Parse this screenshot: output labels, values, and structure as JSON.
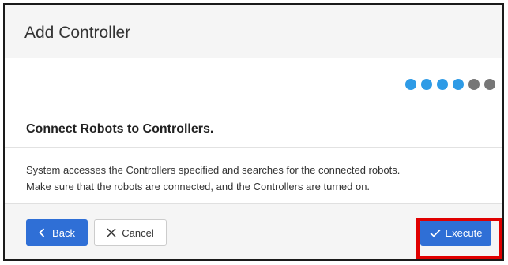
{
  "dialog": {
    "title": "Add Controller",
    "heading": "Connect Robots to Controllers.",
    "description_line1": "System accesses the Controllers specified and searches for the connected robots.",
    "description_line2": "Make sure that the robots are connected, and the Controllers are turned on."
  },
  "steps": {
    "total": 6,
    "completed": 4,
    "active_color": "#2e9be6",
    "inactive_color": "#777777"
  },
  "footer": {
    "back_label": "Back",
    "cancel_label": "Cancel",
    "execute_label": "Execute"
  },
  "colors": {
    "primary": "#2f6fd6",
    "highlight": "#e00000"
  },
  "icons": {
    "back": "chevron-left-icon",
    "cancel": "close-icon",
    "execute": "check-icon"
  }
}
